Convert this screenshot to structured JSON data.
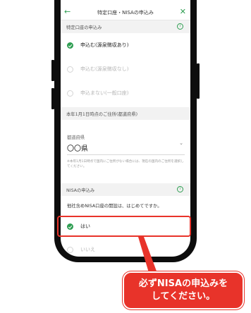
{
  "header": {
    "title": "特定口座・NISAの申込み",
    "back_icon": "arrow-left-icon",
    "close_icon": "close-icon"
  },
  "tokutei": {
    "section_label": "特定口座の申込み",
    "options": [
      {
        "label": "申込む(源泉徴収あり)",
        "selected": true
      },
      {
        "label": "申込む(源泉徴収なし)",
        "selected": false
      },
      {
        "label": "申込まない(一般口座)",
        "selected": false
      }
    ]
  },
  "address": {
    "section_label": "本年1月1日時点のご住所(都道府県)",
    "field_label": "都道府県",
    "field_value": "〇〇県",
    "note": "※本年1月1日時点で国内にご住所がない場合には、現在の国内のご住所を選択してください。"
  },
  "nisa": {
    "section_label": "NISAの申込み",
    "question": "他社含めNISA口座の開設は、はじめてですか。",
    "options": [
      {
        "label": "はい",
        "selected": true
      },
      {
        "label": "いいえ",
        "selected": false
      }
    ]
  },
  "callout": {
    "line1": "必ずNISAの申込みを",
    "line2": "してください。"
  },
  "colors": {
    "accent_green": "#2f9e52",
    "callout_red": "#e8332a"
  }
}
